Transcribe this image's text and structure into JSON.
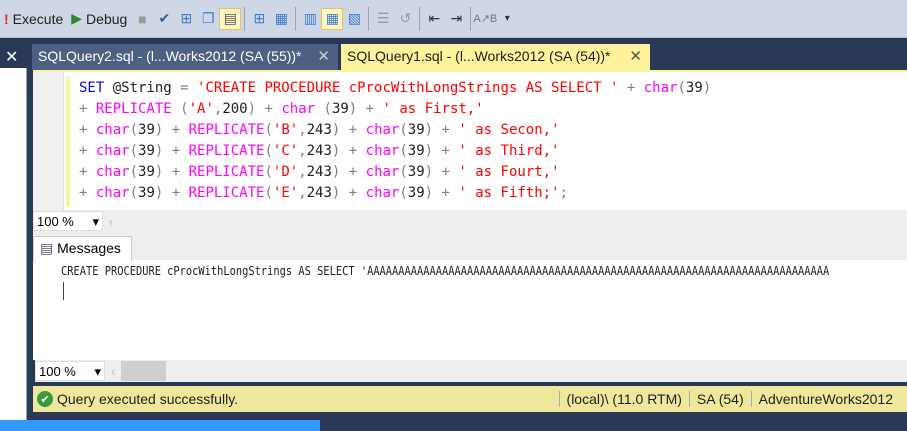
{
  "toolbar": {
    "execute": "Execute",
    "debug": "Debug"
  },
  "tabs": [
    {
      "label": "SQLQuery2.sql - (l...Works2012 (SA (55))*",
      "active": false
    },
    {
      "label": "SQLQuery1.sql - (l...Works2012 (SA (54))*",
      "active": true
    }
  ],
  "code_lines": [
    [
      [
        "k",
        "SET "
      ],
      [
        "v",
        "@String "
      ],
      [
        "o",
        "= "
      ],
      [
        "s",
        "'CREATE PROCEDURE cProcWithLongStrings AS SELECT ' "
      ],
      [
        "o",
        "+ "
      ],
      [
        "f",
        "char"
      ],
      [
        "o",
        "("
      ],
      [
        "v",
        "39"
      ],
      [
        "o",
        ")"
      ]
    ],
    [
      [
        "o",
        "+ "
      ],
      [
        "f",
        "REPLICATE "
      ],
      [
        "o",
        "("
      ],
      [
        "s",
        "'A'"
      ],
      [
        "o",
        ","
      ],
      [
        "v",
        "200"
      ],
      [
        "o",
        ") + "
      ],
      [
        "f",
        "char "
      ],
      [
        "o",
        "("
      ],
      [
        "v",
        "39"
      ],
      [
        "o",
        ") + "
      ],
      [
        "s",
        "' as First,'"
      ]
    ],
    [
      [
        "o",
        "+ "
      ],
      [
        "f",
        "char"
      ],
      [
        "o",
        "("
      ],
      [
        "v",
        "39"
      ],
      [
        "o",
        ") + "
      ],
      [
        "f",
        "REPLICATE"
      ],
      [
        "o",
        "("
      ],
      [
        "s",
        "'B'"
      ],
      [
        "o",
        ","
      ],
      [
        "v",
        "243"
      ],
      [
        "o",
        ") + "
      ],
      [
        "f",
        "char"
      ],
      [
        "o",
        "("
      ],
      [
        "v",
        "39"
      ],
      [
        "o",
        ") + "
      ],
      [
        "s",
        "' as Secon,'"
      ]
    ],
    [
      [
        "o",
        "+ "
      ],
      [
        "f",
        "char"
      ],
      [
        "o",
        "("
      ],
      [
        "v",
        "39"
      ],
      [
        "o",
        ") + "
      ],
      [
        "f",
        "REPLICATE"
      ],
      [
        "o",
        "("
      ],
      [
        "s",
        "'C'"
      ],
      [
        "o",
        ","
      ],
      [
        "v",
        "243"
      ],
      [
        "o",
        ") + "
      ],
      [
        "f",
        "char"
      ],
      [
        "o",
        "("
      ],
      [
        "v",
        "39"
      ],
      [
        "o",
        ") + "
      ],
      [
        "s",
        "' as Third,'"
      ]
    ],
    [
      [
        "o",
        "+ "
      ],
      [
        "f",
        "char"
      ],
      [
        "o",
        "("
      ],
      [
        "v",
        "39"
      ],
      [
        "o",
        ") + "
      ],
      [
        "f",
        "REPLICATE"
      ],
      [
        "o",
        "("
      ],
      [
        "s",
        "'D'"
      ],
      [
        "o",
        ","
      ],
      [
        "v",
        "243"
      ],
      [
        "o",
        ") + "
      ],
      [
        "f",
        "char"
      ],
      [
        "o",
        "("
      ],
      [
        "v",
        "39"
      ],
      [
        "o",
        ") + "
      ],
      [
        "s",
        "' as Fourt,'"
      ]
    ],
    [
      [
        "o",
        "+ "
      ],
      [
        "f",
        "char"
      ],
      [
        "o",
        "("
      ],
      [
        "v",
        "39"
      ],
      [
        "o",
        ") + "
      ],
      [
        "f",
        "REPLICATE"
      ],
      [
        "o",
        "("
      ],
      [
        "s",
        "'E'"
      ],
      [
        "o",
        ","
      ],
      [
        "v",
        "243"
      ],
      [
        "o",
        ") + "
      ],
      [
        "f",
        "char"
      ],
      [
        "o",
        "("
      ],
      [
        "v",
        "39"
      ],
      [
        "o",
        ") + "
      ],
      [
        "s",
        "' as Fifth;'"
      ],
      [
        "o",
        ";"
      ]
    ]
  ],
  "editor_zoom": "100 %",
  "results": {
    "tab": "Messages",
    "message": "CREATE PROCEDURE cProcWithLongStrings AS SELECT 'AAAAAAAAAAAAAAAAAAAAAAAAAAAAAAAAAAAAAAAAAAAAAAAAAAAAAAAAAAAAAAAAAAAAAAAAAA",
    "zoom": "100 %"
  },
  "status": {
    "message": "Query executed successfully.",
    "server": "(local)\\ (11.0 RTM)",
    "user": "SA (54)",
    "database": "AdventureWorks2012",
    "color": "#efe79b"
  }
}
